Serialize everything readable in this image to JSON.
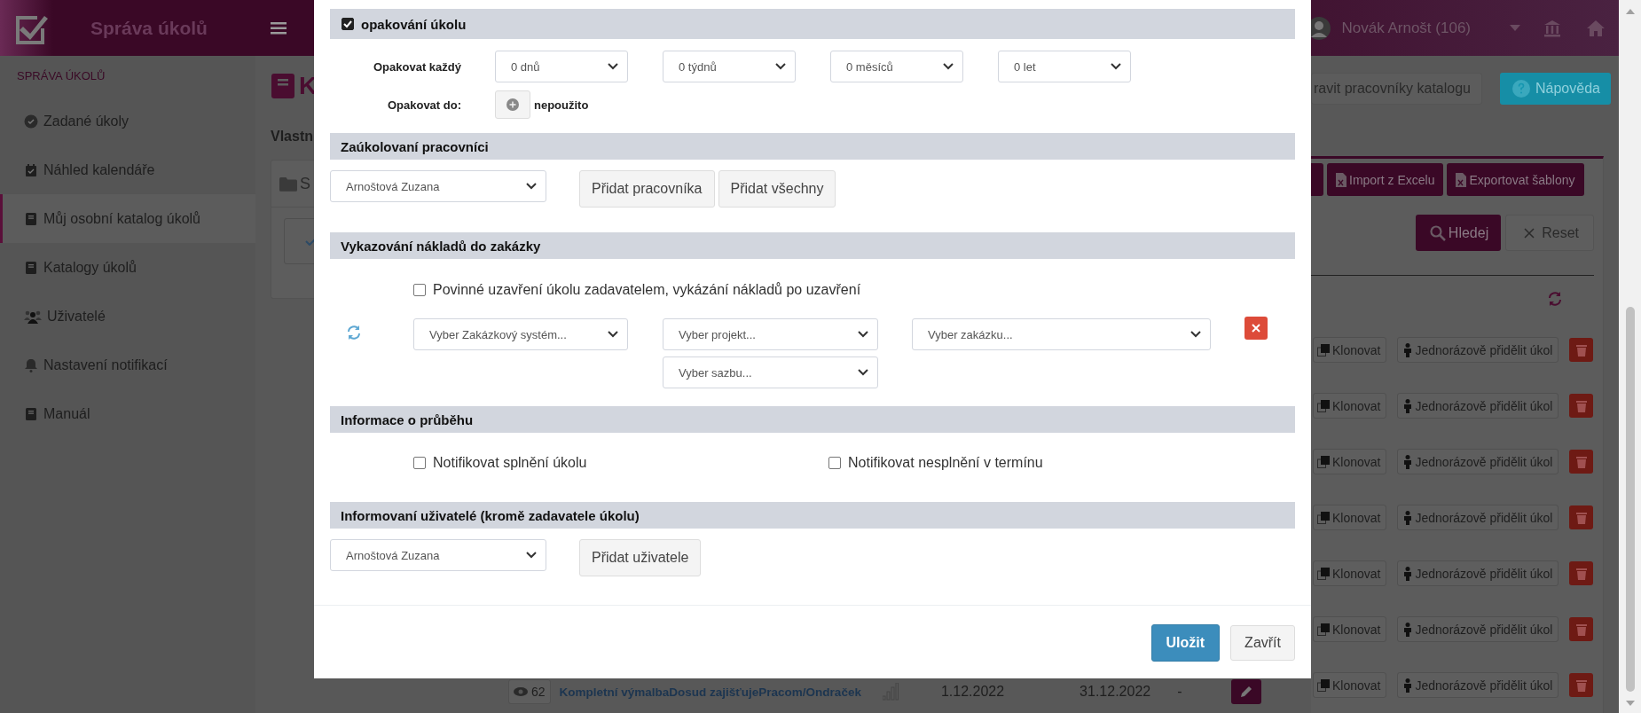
{
  "header": {
    "brand": "Správa úkolů",
    "user": "Novák Arnošt (106)"
  },
  "sidebar": {
    "section": "SPRÁVA ÚKOLŮ",
    "items": [
      {
        "label": "Zadané úkoly",
        "kind": "check",
        "selected": false
      },
      {
        "label": "Náhled kalendáře",
        "kind": "calendar",
        "selected": false
      },
      {
        "label": "Můj osobní katalog úkolů",
        "kind": "book",
        "selected": true
      },
      {
        "label": "Katalogy úkolů",
        "kind": "book",
        "selected": false
      },
      {
        "label": "Uživatelé",
        "kind": "users",
        "selected": false
      },
      {
        "label": "Nastavení notifikací",
        "kind": "bell",
        "selected": false
      },
      {
        "label": "Manuál",
        "kind": "book",
        "selected": false
      }
    ]
  },
  "page": {
    "title": "K",
    "tab": "Vlastn",
    "folder": "S",
    "top_buttons": [
      {
        "label": "ravit pracovníky katalogu",
        "kind": "default"
      },
      {
        "label": "Nápověda",
        "kind": "help"
      }
    ],
    "toolbar": [
      "Import z Excelu",
      "Exportovat šablony"
    ],
    "search": "Hledej",
    "reset": "Reset",
    "rows": [
      {
        "clone": "Klonovat",
        "assign": "Jednorázově přidělit úkol"
      },
      {
        "clone": "Klonovat",
        "assign": "Jednorázově přidělit úkol"
      },
      {
        "clone": "Klonovat",
        "assign": "Jednorázově přidělit úkol"
      },
      {
        "clone": "Klonovat",
        "assign": "Jednorázově přidělit úkol"
      },
      {
        "clone": "Klonovat",
        "assign": "Jednorázově přidělit úkol"
      },
      {
        "clone": "Klonovat",
        "assign": "Jednorázově přidělit úkol"
      },
      {
        "views": "62",
        "title": "Kompletní výmalbaDosud zajišťujePracom/Ondraček",
        "start": "1.12.2022",
        "end": "31.12.2022",
        "note": "-",
        "clone": "Klonovat",
        "assign": "Jednorázově přidělit úkol"
      }
    ]
  },
  "modal": {
    "repeat": {
      "title": "opakování úkolu",
      "enabled": true,
      "every_label": "Opakovat každý",
      "every": [
        "0 dnů",
        "0 týdnů",
        "0 měsíců",
        "0 let"
      ],
      "until_label": "Opakovat do:",
      "until_value": "nepoužito"
    },
    "workers": {
      "title": "Zaúkolovaní pracovníci",
      "select": "Arnoštová Zuzana",
      "buttons": [
        "Přidat pracovníka",
        "Přidat všechny"
      ]
    },
    "costs": {
      "title": "Vykazování nákladů do zakázky",
      "mandatory": {
        "label": "Povinné uzavření úkolu zadavatelem, vykázání nákladů po uzavření",
        "checked": false
      },
      "system": "Vyber Zakázkový systém...",
      "project": "Vyber projekt...",
      "order": "Vyber zakázku...",
      "rate": "Vyber sazbu..."
    },
    "progress": {
      "title": "Informace o průběhu",
      "options": [
        {
          "label": "Notifikovat splnění úkolu",
          "checked": false
        },
        {
          "label": "Notifikovat nesplnění v termínu",
          "checked": false
        }
      ]
    },
    "informed": {
      "title": "Informovaní uživatelé (kromě zadavatele úkolu)",
      "select": "Arnoštová Zuzana",
      "button": "Přidat uživatele"
    },
    "footer": {
      "save": "Uložit",
      "close": "Zavřít"
    }
  }
}
